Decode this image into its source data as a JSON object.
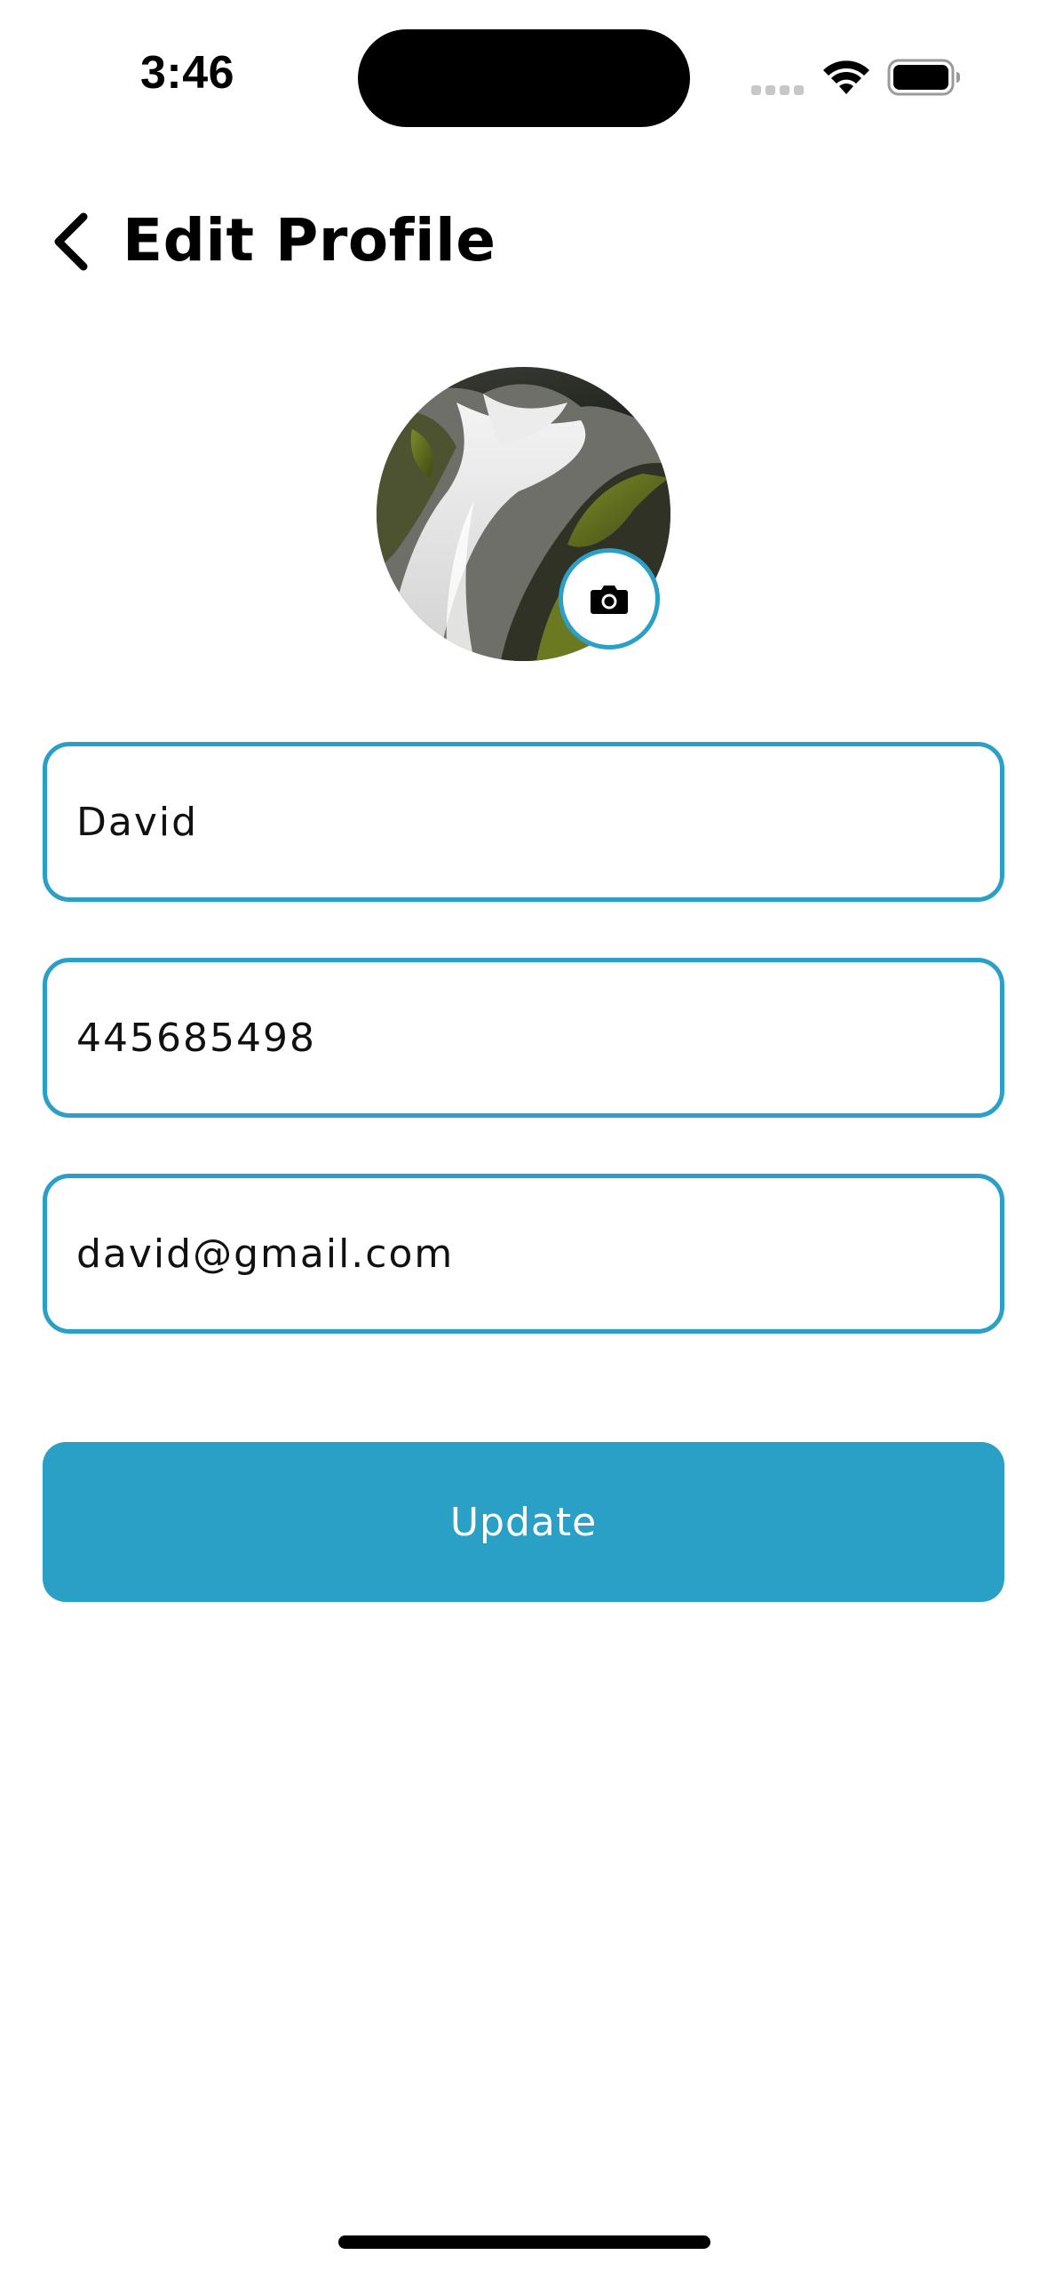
{
  "status_bar": {
    "time": "3:46",
    "wifi_icon": "wifi-icon",
    "battery_icon": "battery-icon",
    "signal_icon": "cell-signal-icon"
  },
  "header": {
    "back_icon": "chevron-left-icon",
    "title": "Edit Profile"
  },
  "avatar": {
    "image": "waterfall-photo",
    "edit_icon": "camera-icon"
  },
  "form": {
    "name": {
      "value": "David"
    },
    "phone": {
      "value": "445685498"
    },
    "email": {
      "value": "david@gmail.com"
    }
  },
  "actions": {
    "update_label": "Update"
  },
  "colors": {
    "accent": "#2ba0c6",
    "background": "#ffffff",
    "text": "#000000"
  }
}
